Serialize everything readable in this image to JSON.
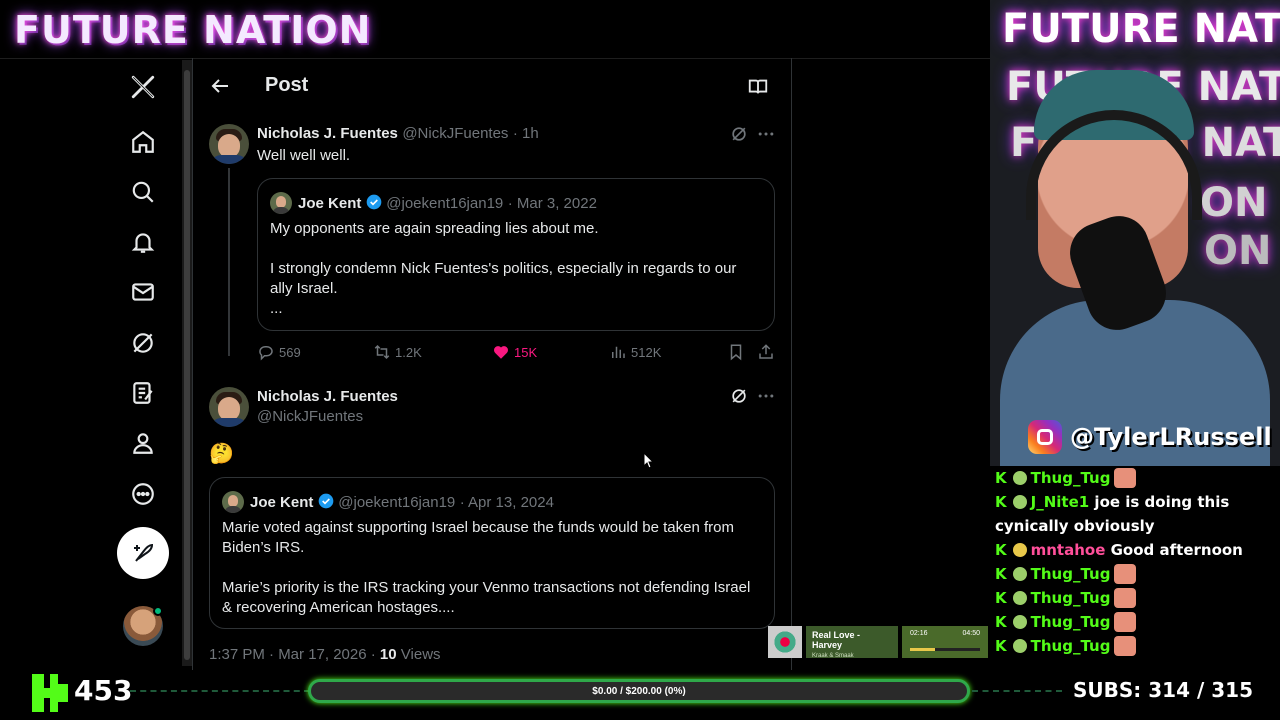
{
  "stream": {
    "brand": "FUTURE NATION",
    "instagram_handle": "@TylerLRussell",
    "viewers": "453",
    "subs_label": "SUBS:",
    "subs_value": "314 / 315",
    "goal_text": "$0.00 / $200.00 (0%)",
    "music": {
      "title": "Real Love - Harvey",
      "artist": "Kraak & Smaak",
      "elapsed": "02:16",
      "total": "04:50"
    },
    "neon_lines": [
      "FUTURE NATION",
      "FUTURE NATION",
      "FUTURE NATION",
      "ON",
      "ON"
    ],
    "chat": [
      {
        "user": "Thug_Tug",
        "message": "",
        "color": "green"
      },
      {
        "user": "J_Nite1",
        "message": "joe is doing this cynically obviously",
        "color": "green"
      },
      {
        "user": "mntahoe",
        "message": "Good afternoon",
        "color": "pink"
      },
      {
        "user": "Thug_Tug",
        "message": "",
        "color": "green"
      },
      {
        "user": "Thug_Tug",
        "message": "",
        "color": "green"
      },
      {
        "user": "Thug_Tug",
        "message": "",
        "color": "green"
      },
      {
        "user": "Thug_Tug",
        "message": "",
        "color": "green"
      }
    ]
  },
  "x": {
    "nav": [
      "x-logo-icon",
      "home-icon",
      "search-icon",
      "bell-icon",
      "mail-icon",
      "grok-icon",
      "notes-icon",
      "profile-icon",
      "more-icon"
    ],
    "header": {
      "title": "Post"
    },
    "tweet1": {
      "name": "Nicholas J. Fuentes",
      "handle": "@NickJFuentes",
      "time": "· 1h",
      "text": "Well well well.",
      "quote": {
        "name": "Joe Kent",
        "handle": "@joekent16jan19",
        "date": "· Mar 3, 2022",
        "line1": "My opponents are again spreading lies about me.",
        "line2": "I strongly condemn Nick Fuentes's politics, especially in regards to our ally Israel.",
        "line3": "..."
      },
      "stats": {
        "replies": "569",
        "reposts": "1.2K",
        "likes": "15K",
        "views": "512K"
      }
    },
    "tweet2": {
      "name": "Nicholas J. Fuentes",
      "handle": "@NickJFuentes",
      "emoji": "🤔",
      "quote": {
        "name": "Joe Kent",
        "handle": "@joekent16jan19",
        "date": "· Apr 13, 2024",
        "para1": "Marie voted against supporting Israel because the funds would be taken from Biden’s IRS.",
        "para2": "Marie’s priority is the IRS tracking your Venmo transactions not defending Israel & recovering American hostages...."
      },
      "timestamp": "1:37 PM · Mar 17, 2026 ·",
      "views_count": "10",
      "views_label": "Views"
    }
  },
  "colors": {
    "kick_green": "#53fc18",
    "like_pink": "#f91880",
    "verified_blue": "#1d9bf0"
  }
}
